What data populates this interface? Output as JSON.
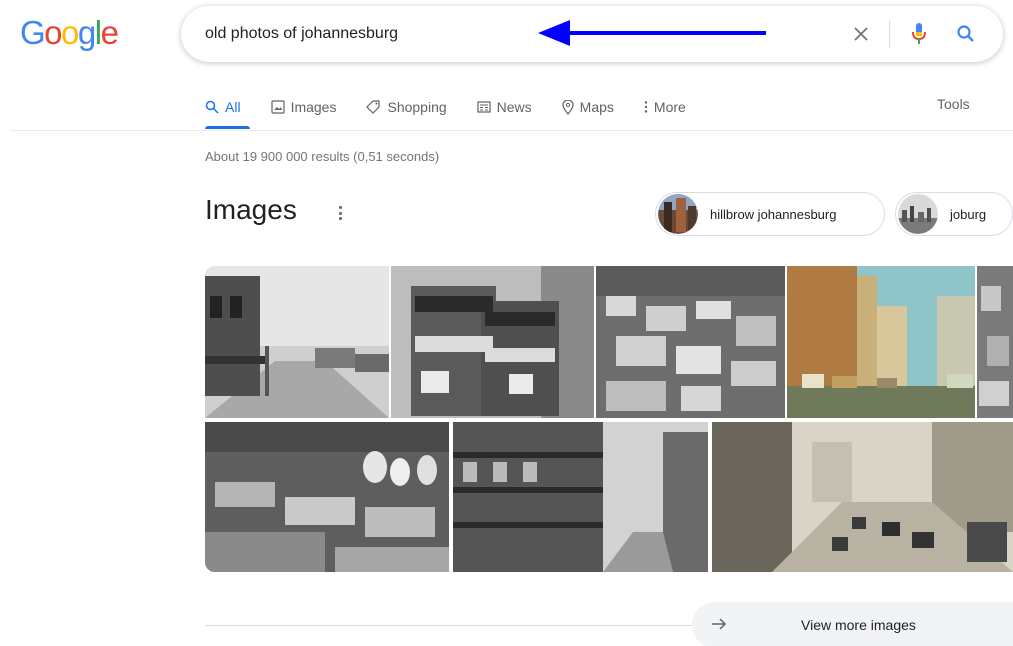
{
  "logo": {
    "letters": [
      {
        "char": "G",
        "color": "#4285F4"
      },
      {
        "char": "o",
        "color": "#EA4335"
      },
      {
        "char": "o",
        "color": "#FBBC05"
      },
      {
        "char": "g",
        "color": "#4285F4"
      },
      {
        "char": "l",
        "color": "#34A853"
      },
      {
        "char": "e",
        "color": "#EA4335"
      }
    ]
  },
  "search": {
    "query": "old photos of johannesburg",
    "clear_icon": "close-icon",
    "mic_icon": "microphone-icon",
    "search_icon": "search-icon",
    "annotation_arrow_color": "#0000ff"
  },
  "tabs": [
    {
      "label": "All",
      "icon": "search-icon",
      "active": true
    },
    {
      "label": "Images",
      "icon": "image-icon",
      "active": false
    },
    {
      "label": "Shopping",
      "icon": "tag-icon",
      "active": false
    },
    {
      "label": "News",
      "icon": "newspaper-icon",
      "active": false
    },
    {
      "label": "Maps",
      "icon": "map-pin-icon",
      "active": false
    },
    {
      "label": "More",
      "icon": "more-vert-icon",
      "active": false
    }
  ],
  "tools_label": "Tools",
  "result_stats": "About 19 900 000 results (0,51 seconds)",
  "images_section": {
    "heading": "Images",
    "chips": [
      {
        "label": "hillbrow johannesburg"
      },
      {
        "label": "joburg"
      }
    ],
    "thumbnails": [
      {
        "description": "street scene black and white"
      },
      {
        "description": "double decker trams"
      },
      {
        "description": "aerial view of city"
      },
      {
        "description": "colour street scene"
      },
      {
        "description": "aerial view partial"
      },
      {
        "description": "aerial view mine dumps"
      },
      {
        "description": "street with balconies"
      },
      {
        "description": "busy street tinted"
      }
    ],
    "view_more_label": "View more images"
  },
  "colors": {
    "accent": "#1a73e8",
    "text_secondary": "#5f6368"
  }
}
